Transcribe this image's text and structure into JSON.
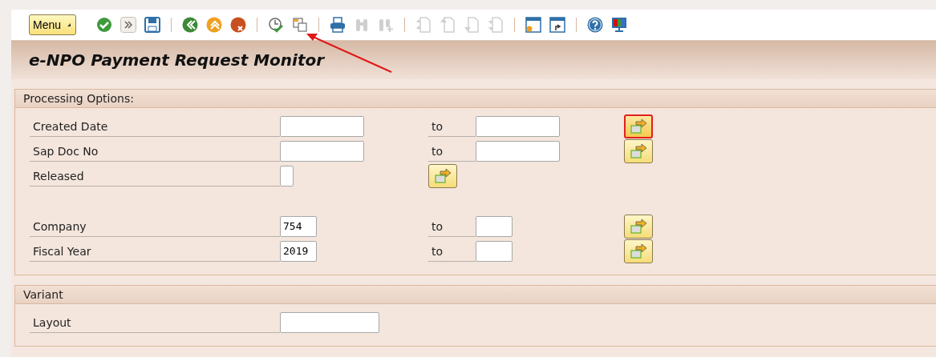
{
  "toolbar": {
    "menu_button": "Menu",
    "items": [
      {
        "kind": "check",
        "disabled": false
      },
      {
        "kind": "forward",
        "disabled": false
      },
      {
        "kind": "save",
        "disabled": false
      },
      {
        "kind": "separator"
      },
      {
        "kind": "back",
        "disabled": false
      },
      {
        "kind": "up",
        "disabled": false
      },
      {
        "kind": "cancel",
        "disabled": false
      },
      {
        "kind": "separator"
      },
      {
        "kind": "execute",
        "disabled": false
      },
      {
        "kind": "copy",
        "disabled": false
      },
      {
        "kind": "separator"
      },
      {
        "kind": "print",
        "disabled": false
      },
      {
        "kind": "find",
        "disabled": true
      },
      {
        "kind": "findnext",
        "disabled": true
      },
      {
        "kind": "separator"
      },
      {
        "kind": "firstpage",
        "disabled": true
      },
      {
        "kind": "prevpage",
        "disabled": true
      },
      {
        "kind": "nextpage",
        "disabled": true
      },
      {
        "kind": "lastpage",
        "disabled": true
      },
      {
        "kind": "separator"
      },
      {
        "kind": "newwindow",
        "disabled": false
      },
      {
        "kind": "shortcut",
        "disabled": false
      },
      {
        "kind": "separator"
      },
      {
        "kind": "help",
        "disabled": false
      },
      {
        "kind": "monitor",
        "disabled": false
      }
    ]
  },
  "title": "e-NPO Payment Request Monitor",
  "groups": [
    {
      "title": "Processing Options:",
      "blocks": [
        [
          {
            "kind": "range",
            "label": "Created Date",
            "to_label": "to",
            "focused": true
          },
          {
            "kind": "range",
            "label": "Sap Doc No",
            "to_label": "to",
            "focused": false
          },
          {
            "kind": "flag",
            "label": "Released",
            "checked": false,
            "focused": false
          }
        ],
        [
          {
            "kind": "shortrange",
            "label": "Company",
            "from": "754",
            "to_label": "to",
            "focused": false
          },
          {
            "kind": "shortrange",
            "label": "Fiscal Year",
            "from": "2019",
            "to_label": "to",
            "focused": false
          }
        ]
      ]
    },
    {
      "title": "Variant",
      "blocks": [
        [
          {
            "kind": "single",
            "label": "Layout"
          }
        ]
      ]
    }
  ]
}
